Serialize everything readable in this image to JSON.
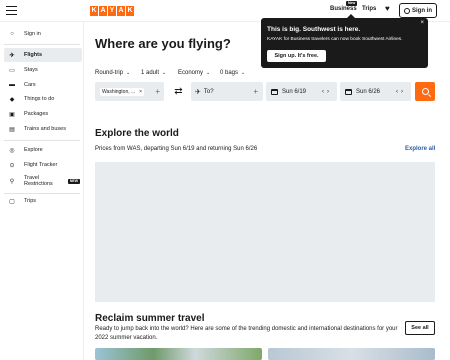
{
  "header": {
    "logo_letters": [
      "K",
      "A",
      "Y",
      "A",
      "K"
    ],
    "business_label": "Business",
    "business_badge": "New",
    "trips_label": "Trips",
    "sign_in_label": "Sign in",
    "brand_color": "#ff690f"
  },
  "sidebar": {
    "sign_in": "Sign in",
    "items": [
      {
        "label": "Flights",
        "icon": "plane-icon",
        "active": true
      },
      {
        "label": "Stays",
        "icon": "bed-icon"
      },
      {
        "label": "Cars",
        "icon": "car-icon"
      },
      {
        "label": "Things to do",
        "icon": "ticket-icon"
      },
      {
        "label": "Packages",
        "icon": "package-icon"
      },
      {
        "label": "Trains and buses",
        "icon": "train-icon"
      }
    ],
    "secondary": [
      {
        "label": "Explore",
        "icon": "globe-icon"
      },
      {
        "label": "Flight Tracker",
        "icon": "tracker-icon"
      },
      {
        "label": "Travel Restrictions",
        "icon": "restriction-icon",
        "badge": "NEW"
      }
    ],
    "trips": "Trips"
  },
  "main": {
    "title": "Where are you flying?",
    "options": {
      "trip_type": "Round-trip",
      "travelers": "1 adult",
      "cabin": "Economy",
      "bags": "0 bags"
    },
    "from_value": "Washington, ...",
    "to_placeholder": "To?",
    "date_depart": "Sun 6/19",
    "date_return": "Sun 6/26"
  },
  "promo": {
    "title": "This is big. Southwest is here.",
    "text": "KAYAK for Business travelers can now book Southwest Airlines.",
    "button": "Sign up. It's free."
  },
  "explore": {
    "title": "Explore the world",
    "subtitle": "Prices from WAS, departing Sun 6/19 and returning Sun 6/26",
    "link": "Explore all"
  },
  "reclaim": {
    "title": "Reclaim summer travel",
    "subtitle": "Ready to jump back into the world? Here are some of the trending domestic and international destinations for your 2022 summer vacation.",
    "button": "See all"
  }
}
